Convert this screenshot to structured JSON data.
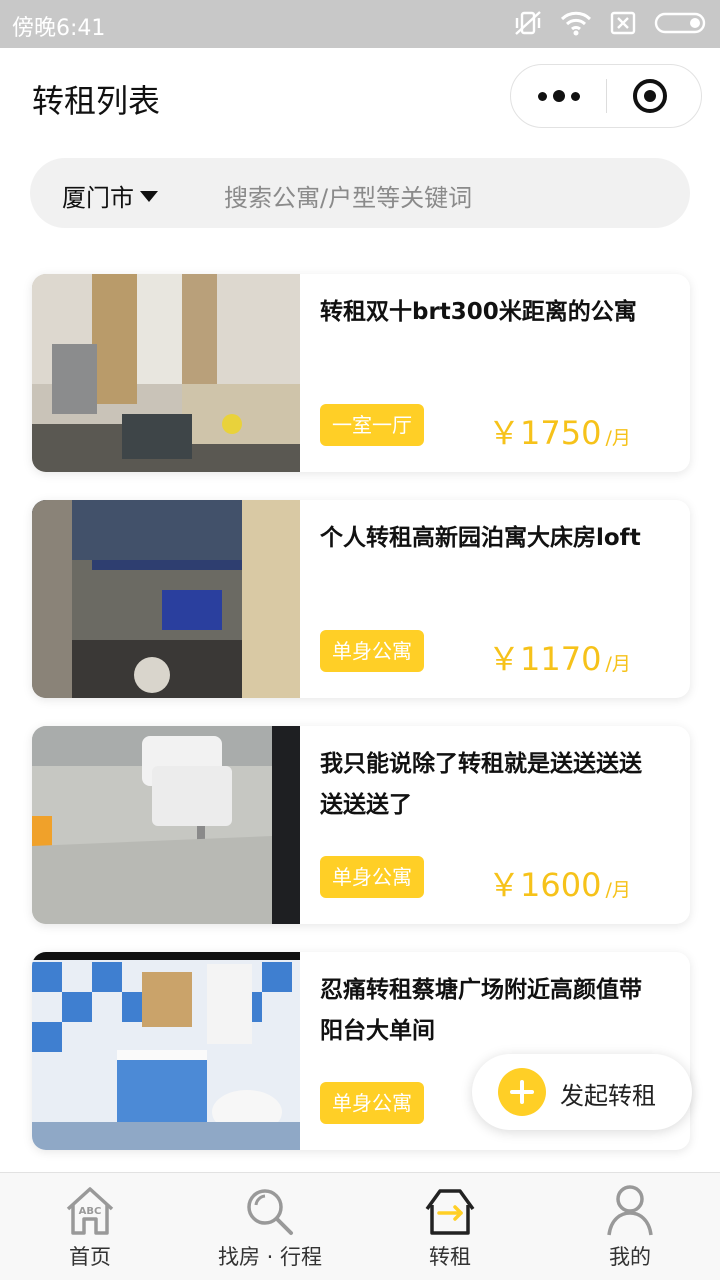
{
  "status": {
    "time": "傍晚6:41"
  },
  "nav": {
    "title": "转租列表"
  },
  "search": {
    "city": "厦门市",
    "placeholder": "搜索公寓/户型等关键词"
  },
  "listings": [
    {
      "title": "转租双十brt300米距离的公寓",
      "tag": "一室一厅",
      "price": "￥1750",
      "unit": "/月"
    },
    {
      "title": "个人转租高新园泊寓大床房loft",
      "tag": "单身公寓",
      "price": "￥1170",
      "unit": "/月"
    },
    {
      "title": "我只能说除了转租就是送送送送送送送了",
      "tag": "单身公寓",
      "price": "￥1600",
      "unit": "/月"
    },
    {
      "title": "忍痛转租蔡塘广场附近高颜值带阳台大单间",
      "tag": "单身公寓",
      "price": "",
      "unit": ""
    }
  ],
  "fab": {
    "label": "发起转租"
  },
  "tabs": [
    {
      "label": "首页",
      "icon": "home-abc-icon"
    },
    {
      "label": "找房 · 行程",
      "icon": "magnifier-icon"
    },
    {
      "label": "转租",
      "icon": "house-transfer-icon"
    },
    {
      "label": "我的",
      "icon": "person-icon"
    }
  ],
  "colors": {
    "accent": "#ffcf26",
    "price": "#f6c21a",
    "statusbar": "#c8c8c8"
  }
}
